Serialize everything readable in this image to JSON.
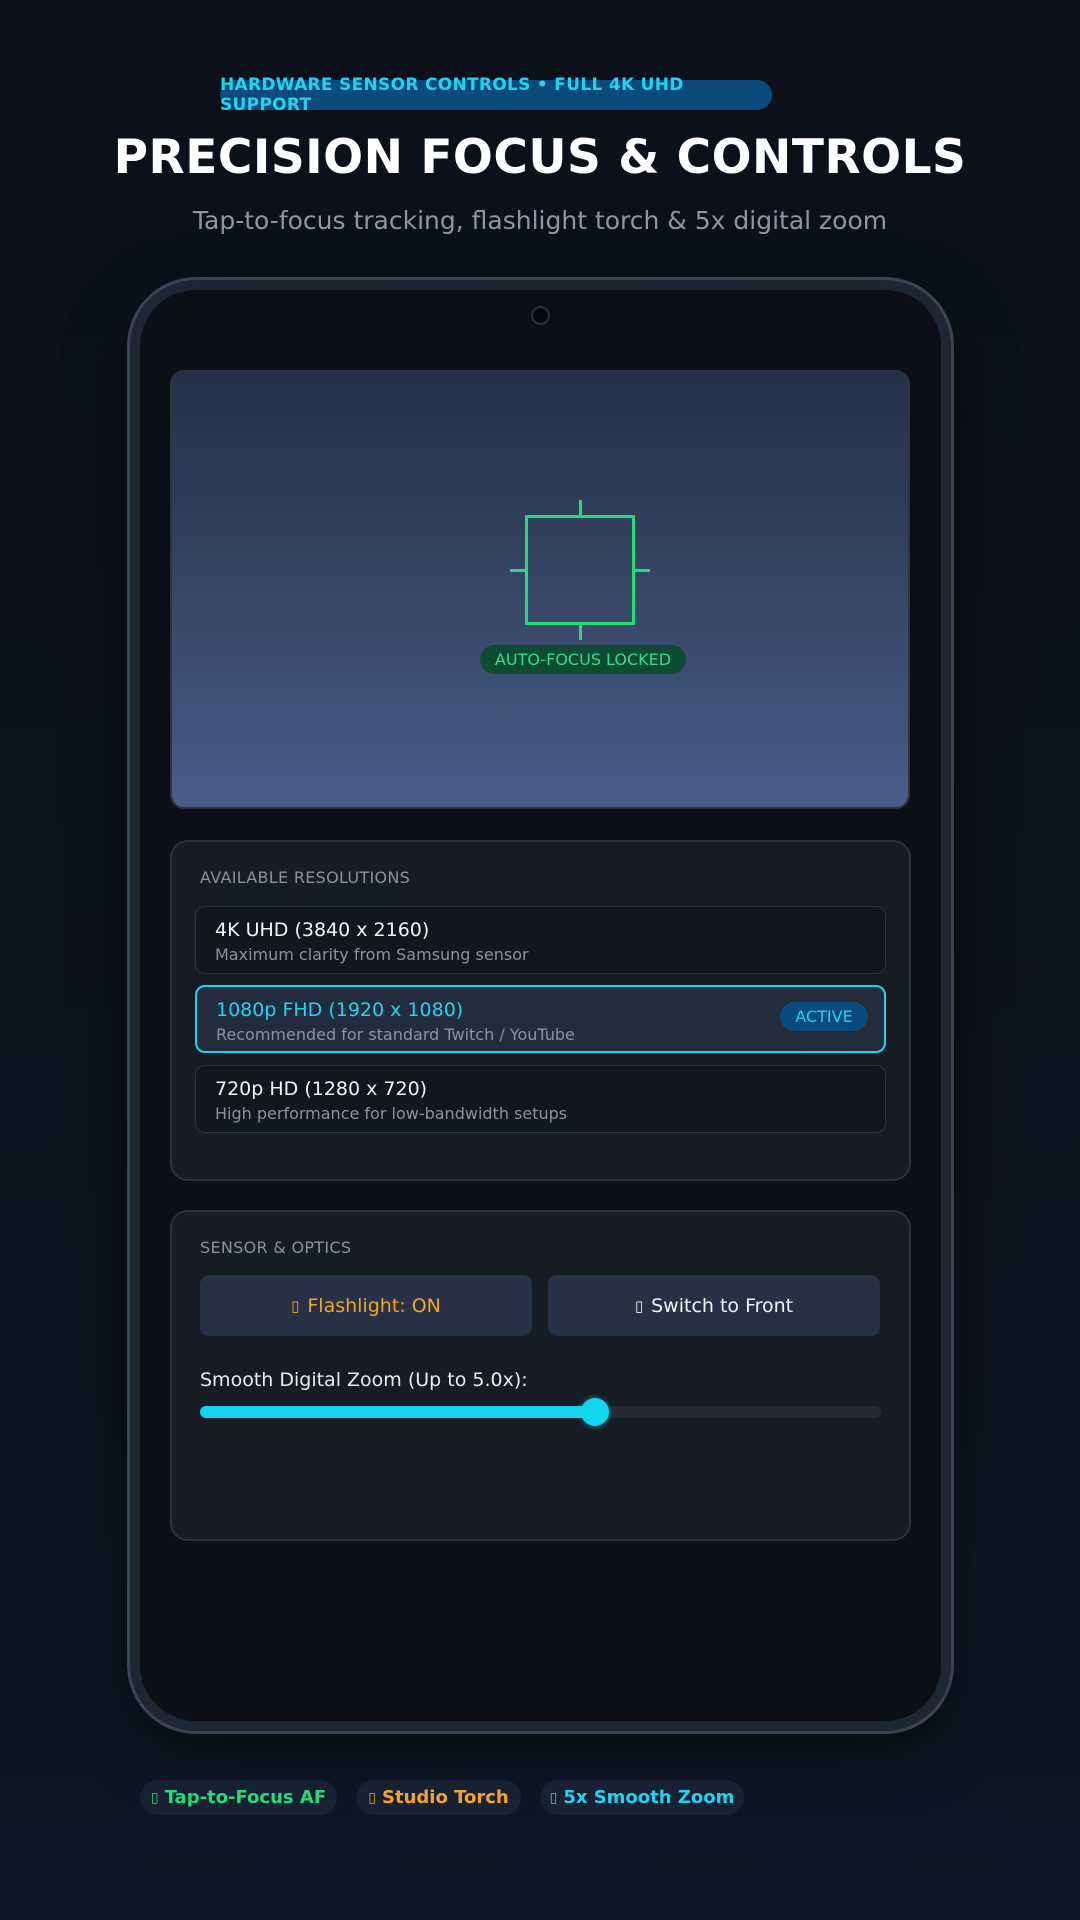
{
  "hero": {
    "badge": "HARDWARE SENSOR CONTROLS • FULL 4K UHD SUPPORT",
    "title": "PRECISION FOCUS & CONTROLS",
    "subtitle": "Tap-to-focus tracking, flashlight torch & 5x digital zoom"
  },
  "viewfinder": {
    "af_status": "AUTO-FOCUS LOCKED"
  },
  "resolutions": {
    "heading": "AVAILABLE RESOLUTIONS",
    "options": [
      {
        "title": "4K UHD (3840 x 2160)",
        "subtitle": "Maximum clarity from Samsung sensor"
      },
      {
        "title": "1080p FHD (1920 x 1080)",
        "subtitle": "Recommended for standard Twitch / YouTube",
        "badge": "ACTIVE"
      },
      {
        "title": "720p HD (1280 x 720)",
        "subtitle": "High performance for low-bandwidth setups"
      }
    ]
  },
  "sensor": {
    "heading": "SENSOR & OPTICS",
    "flashlight_label": "Flashlight: ON",
    "flashlight_icon": "flashlight-icon",
    "switch_label": "Switch to Front",
    "switch_icon": "camera-switch-icon",
    "zoom_label": "Smooth Digital Zoom (Up to 5.0x):",
    "zoom_fraction": 0.58
  },
  "features": [
    {
      "label": "Tap-to-Focus AF",
      "icon": "focus-icon",
      "color": "#22dd77"
    },
    {
      "label": "Studio Torch",
      "icon": "torch-icon",
      "color": "#f5a524"
    },
    {
      "label": "5x Smooth Zoom",
      "icon": "zoom-icon",
      "color": "#22d3ee"
    }
  ],
  "colors": {
    "accent": "#22d3ee",
    "focus_green": "#22dd77",
    "torch_amber": "#f5a524",
    "background": "#0b101a"
  }
}
